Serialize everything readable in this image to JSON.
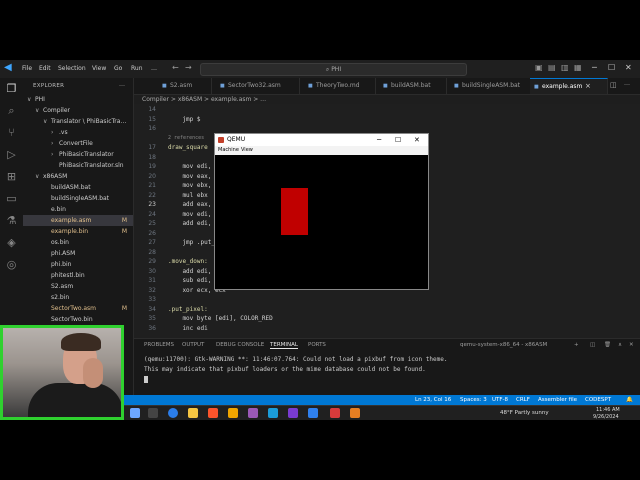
{
  "titlebar": {
    "menu": [
      "File",
      "Edit",
      "Selection",
      "View",
      "Go",
      "Run",
      "…"
    ],
    "command_center": "PHI",
    "controls": [
      "─",
      "☐",
      "✕"
    ]
  },
  "explorer": {
    "title": "EXPLORER",
    "items": [
      {
        "label": "PHI",
        "indent": 0,
        "arrow": "∨",
        "badge": ""
      },
      {
        "label": "Compiler",
        "indent": 1,
        "arrow": "∨",
        "badge": ""
      },
      {
        "label": "Translator \\ PhiBasicTra…",
        "indent": 2,
        "arrow": "∨",
        "badge": ""
      },
      {
        "label": ".vs",
        "indent": 3,
        "arrow": "›",
        "badge": ""
      },
      {
        "label": "ConvertFile",
        "indent": 3,
        "arrow": "›",
        "badge": ""
      },
      {
        "label": "PhiBasicTranslator",
        "indent": 3,
        "arrow": "›",
        "badge": ""
      },
      {
        "label": "PhiBasicTranslator.sln",
        "indent": 3,
        "arrow": "",
        "badge": ""
      },
      {
        "label": "x86ASM",
        "indent": 1,
        "arrow": "∨",
        "badge": ""
      },
      {
        "label": "buildASM.bat",
        "indent": 2,
        "arrow": "",
        "badge": ""
      },
      {
        "label": "buildSingleASM.bat",
        "indent": 2,
        "arrow": "",
        "badge": ""
      },
      {
        "label": "e.bin",
        "indent": 2,
        "arrow": "",
        "badge": ""
      },
      {
        "label": "example.asm",
        "indent": 2,
        "arrow": "",
        "badge": "M"
      },
      {
        "label": "example.bin",
        "indent": 2,
        "arrow": "",
        "badge": "M"
      },
      {
        "label": "os.bin",
        "indent": 2,
        "arrow": "",
        "badge": ""
      },
      {
        "label": "phi.ASM",
        "indent": 2,
        "arrow": "",
        "badge": ""
      },
      {
        "label": "phi.bin",
        "indent": 2,
        "arrow": "",
        "badge": ""
      },
      {
        "label": "phitestl.bin",
        "indent": 2,
        "arrow": "",
        "badge": ""
      },
      {
        "label": "S2.asm",
        "indent": 2,
        "arrow": "",
        "badge": ""
      },
      {
        "label": "s2.bin",
        "indent": 2,
        "arrow": "",
        "badge": ""
      },
      {
        "label": "SectorTwo.asm",
        "indent": 2,
        "arrow": "",
        "badge": "M"
      },
      {
        "label": "SectorTwo.bin",
        "indent": 2,
        "arrow": "",
        "badge": ""
      }
    ]
  },
  "tabs": [
    {
      "label": "S2.asm",
      "active": false
    },
    {
      "label": "SectorTwo32.asm",
      "active": false
    },
    {
      "label": "TheoryTwo.md",
      "active": false
    },
    {
      "label": "buildASM.bat",
      "active": false
    },
    {
      "label": "buildSingleASM.bat",
      "active": false
    },
    {
      "label": "example.asm",
      "active": true
    }
  ],
  "breadcrumb": "Compiler > x86ASM > example.asm > …",
  "editor": {
    "lines": [
      {
        "n": "14",
        "code": "",
        "kind": "plain"
      },
      {
        "n": "15",
        "code": "    jmp $",
        "kind": "kw"
      },
      {
        "n": "16",
        "code": "",
        "kind": "plain"
      },
      {
        "n": "",
        "code": "2 references",
        "kind": "ref"
      },
      {
        "n": "17",
        "code": "draw_square",
        "kind": "lbl"
      },
      {
        "n": "18",
        "code": "",
        "kind": "plain"
      },
      {
        "n": "19",
        "code": "    mov edi,",
        "kind": "kw"
      },
      {
        "n": "20",
        "code": "    mov eax,",
        "kind": "kw"
      },
      {
        "n": "21",
        "code": "    mov ebx,",
        "kind": "kw"
      },
      {
        "n": "22",
        "code": "    mul ebx",
        "kind": "kw"
      },
      {
        "n": "23",
        "code": "    add eax,",
        "kind": "kw"
      },
      {
        "n": "24",
        "code": "    mov edi,",
        "kind": "kw"
      },
      {
        "n": "25",
        "code": "    add edi,",
        "kind": "kw"
      },
      {
        "n": "26",
        "code": "",
        "kind": "plain"
      },
      {
        "n": "27",
        "code": "    jmp .put_",
        "kind": "kw"
      },
      {
        "n": "28",
        "code": "",
        "kind": "plain"
      },
      {
        "n": "29",
        "code": ".move_down:",
        "kind": "lbl"
      },
      {
        "n": "30",
        "code": "    add edi,",
        "kind": "kw"
      },
      {
        "n": "31",
        "code": "    sub edi,",
        "kind": "kw"
      },
      {
        "n": "32",
        "code": "    xor ecx, ecx",
        "kind": "kw"
      },
      {
        "n": "33",
        "code": "",
        "kind": "plain"
      },
      {
        "n": "34",
        "code": ".put_pixel:",
        "kind": "lbl"
      },
      {
        "n": "35",
        "code": "    mov byte [edi], COLOR_RED",
        "kind": "kw"
      },
      {
        "n": "36",
        "code": "    inc edi",
        "kind": "kw"
      }
    ]
  },
  "qemu": {
    "title": "QEMU",
    "menu": [
      "Machine",
      "View"
    ],
    "rect_color": "#c00000",
    "controls": [
      "─",
      "☐",
      "✕"
    ]
  },
  "panel": {
    "tabs": [
      "PROBLEMS",
      "OUTPUT",
      "DEBUG CONSOLE",
      "TERMINAL",
      "PORTS"
    ],
    "active_tab": "TERMINAL",
    "terminal_selector": "qemu-system-x86_64 - x86ASM",
    "terminal_lines": [
      "(qemu:11700): Gtk-WARNING **: 11:46:07.764: Could not load a pixbuf from icon theme.",
      "This may indicate that pixbuf loaders or the mime database could not be found."
    ]
  },
  "statusbar": {
    "position": "Ln 23, Col 16",
    "spaces": "Spaces: 3",
    "encoding": "UTF-8",
    "eol": "CRLF",
    "language": "Assembler file",
    "extension": "CODESPT"
  },
  "taskbar": {
    "weather": "48°F Partly sunny",
    "time": "11:46 AM",
    "date": "9/26/2024"
  },
  "colors": {
    "accent": "#0078d4",
    "webcam_border": "#2fd12f",
    "qemu_rect": "#c00000"
  }
}
